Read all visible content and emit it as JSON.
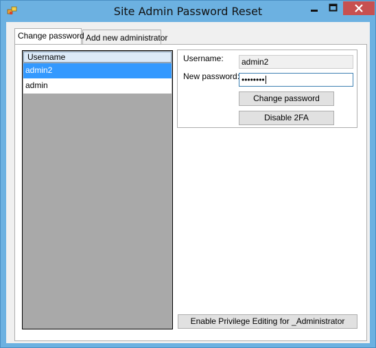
{
  "window": {
    "title": "Site Admin Password Reset",
    "controls": {
      "minimize": "minimize",
      "maximize": "maximize",
      "close": "close"
    },
    "colors": {
      "frame": "#6cb1e1",
      "close": "#c75050",
      "selection": "#3399ff"
    }
  },
  "tabs": [
    {
      "label": "Change password",
      "active": true
    },
    {
      "label": "Add new administrator",
      "active": false
    }
  ],
  "user_list": {
    "column_header": "Username",
    "rows": [
      {
        "label": "admin2",
        "selected": true
      },
      {
        "label": "admin",
        "selected": false
      }
    ]
  },
  "form": {
    "username_label": "Username:",
    "username_value": "admin2",
    "password_label": "New password:",
    "password_value": "••••••••",
    "change_password_label": "Change password",
    "disable_2fa_label": "Disable 2FA"
  },
  "footer": {
    "privilege_button_label": "Enable Privilege Editing for _Administrator"
  }
}
